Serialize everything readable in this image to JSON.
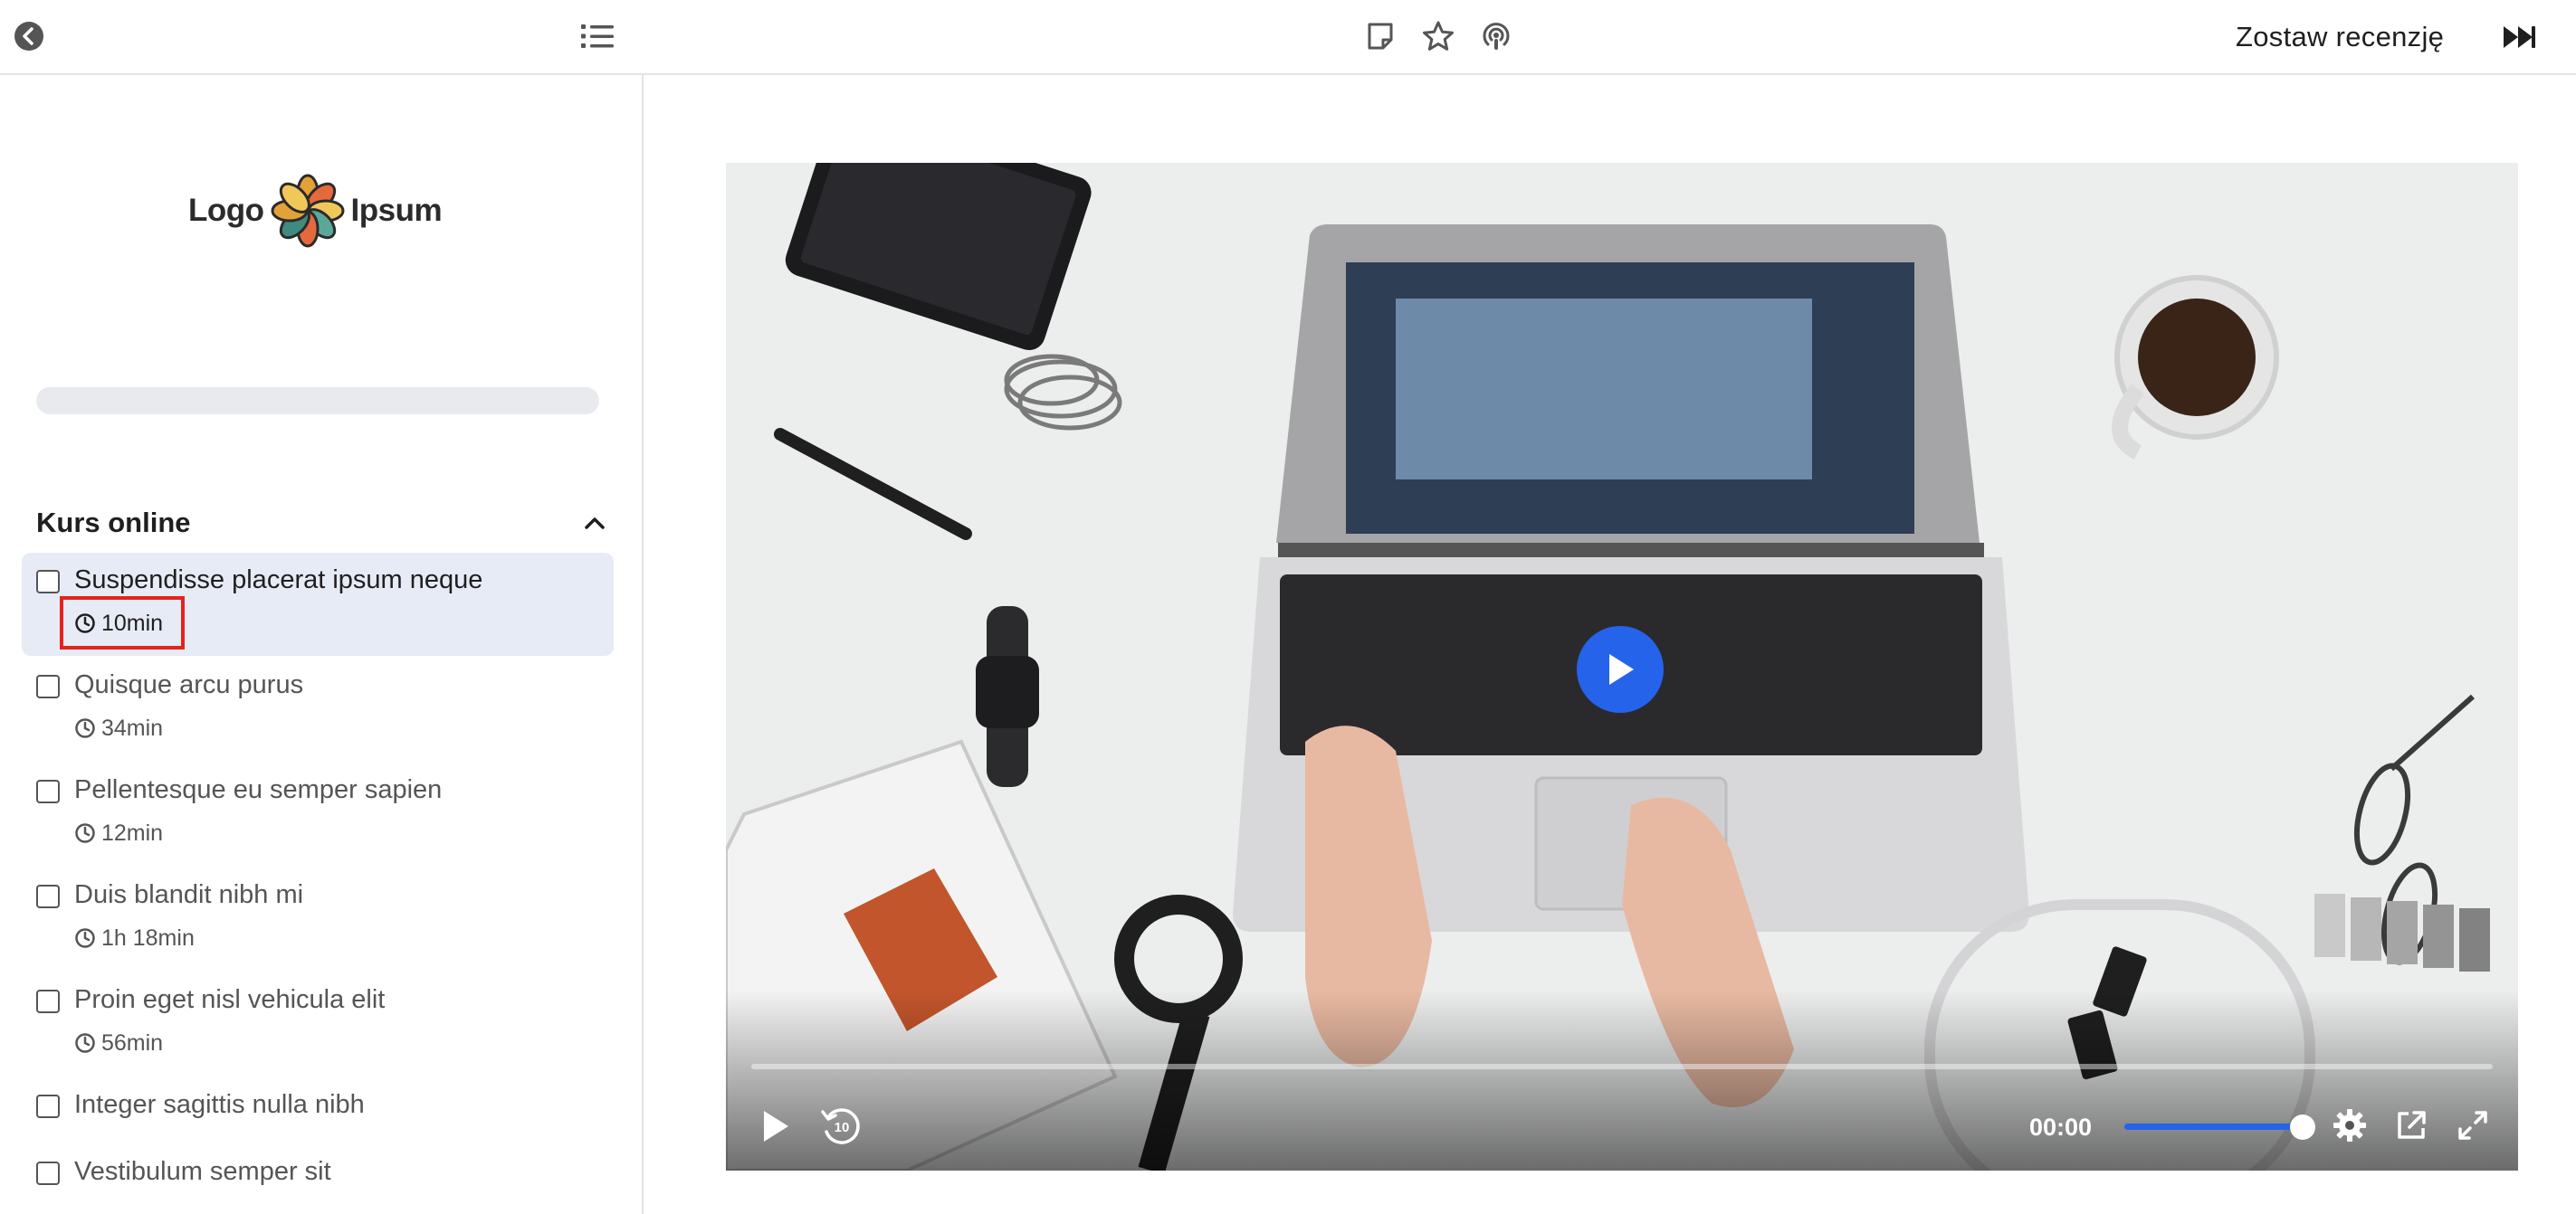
{
  "topbar": {
    "review_label": "Zostaw recenzję",
    "icons": [
      "back-circle-icon",
      "list-icon",
      "note-icon",
      "star-icon",
      "podcast-icon",
      "fast-forward-icon"
    ]
  },
  "sidebar": {
    "logo": {
      "left": "Logo",
      "right": "Ipsum"
    },
    "progress": 0,
    "section_title": "Kurs online",
    "lessons": [
      {
        "title": "Suspendisse placerat ipsum neque",
        "duration": "10min",
        "active": true
      },
      {
        "title": "Quisque arcu purus",
        "duration": "34min"
      },
      {
        "title": "Pellentesque eu semper sapien",
        "duration": "12min"
      },
      {
        "title": "Duis blandit nibh mi",
        "duration": "1h 18min"
      },
      {
        "title": "Proin eget nisl vehicula elit",
        "duration": "56min"
      },
      {
        "title": "Integer sagittis nulla nibh",
        "duration": ""
      },
      {
        "title": "Vestibulum semper sit",
        "duration": ""
      }
    ]
  },
  "player": {
    "time": "00:00",
    "rewind_seconds": "10",
    "volume": 1,
    "colors": {
      "accent": "#2563eb"
    }
  }
}
